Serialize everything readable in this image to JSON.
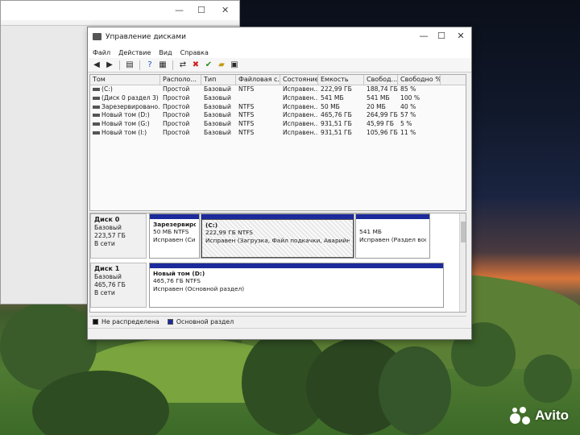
{
  "window": {
    "title": "Управление дисками",
    "controls": {
      "minimize": "—",
      "maximize": "☐",
      "close": "✕"
    }
  },
  "menu": [
    "Файл",
    "Действие",
    "Вид",
    "Справка"
  ],
  "toolbar_icons": [
    "back-arrow-icon",
    "forward-arrow-icon",
    "list-view-icon",
    "help-icon",
    "properties-icon",
    "connect-icon",
    "delete-icon",
    "check-icon",
    "folder-icon",
    "settings-icon"
  ],
  "volumes": {
    "columns": [
      "Том",
      "Располо...",
      "Тип",
      "Файловая с...",
      "Состояние",
      "Емкость",
      "Свобод...",
      "Свободно %"
    ],
    "rows": [
      [
        "(C:)",
        "Простой",
        "Базовый",
        "NTFS",
        "Исправен...",
        "222,99 ГБ",
        "188,74 ГБ",
        "85 %"
      ],
      [
        "(Диск 0 раздел 3)",
        "Простой",
        "Базовый",
        "",
        "Исправен...",
        "541 МБ",
        "541 МБ",
        "100 %"
      ],
      [
        "Зарезервировано...",
        "Простой",
        "Базовый",
        "NTFS",
        "Исправен...",
        "50 МБ",
        "20 МБ",
        "40 %"
      ],
      [
        "Новый том (D:)",
        "Простой",
        "Базовый",
        "NTFS",
        "Исправен...",
        "465,76 ГБ",
        "264,99 ГБ",
        "57 %"
      ],
      [
        "Новый том (G:)",
        "Простой",
        "Базовый",
        "NTFS",
        "Исправен...",
        "931,51 ГБ",
        "45,99 ГБ",
        "5 %"
      ],
      [
        "Новый том (I:)",
        "Простой",
        "Базовый",
        "NTFS",
        "Исправен...",
        "931,51 ГБ",
        "105,96 ГБ",
        "11 %"
      ]
    ]
  },
  "disks": [
    {
      "name": "Диск 0",
      "type": "Базовый",
      "size": "223,57 ГБ",
      "status": "В сети",
      "partitions": [
        {
          "name": "Зарезервиров",
          "size": "50 МБ NTFS",
          "status": "Исправен (Сис"
        },
        {
          "name": "(C:)",
          "size": "222,99 ГБ NTFS",
          "status": "Исправен (Загрузка, Файл подкачки, Аварийный дам"
        },
        {
          "name": "",
          "size": "541 МБ",
          "status": "Исправен (Раздел восста"
        }
      ]
    },
    {
      "name": "Диск 1",
      "type": "Базовый",
      "size": "465,76 ГБ",
      "status": "В сети",
      "partitions": [
        {
          "name": "Новый том  (D:)",
          "size": "465,76 ГБ NTFS",
          "status": "Исправен (Основной раздел)"
        }
      ]
    }
  ],
  "legend": [
    {
      "label": "Не распределена",
      "color": "#111111"
    },
    {
      "label": "Основной раздел",
      "color": "#1c2a9c"
    }
  ],
  "watermark": {
    "text": "Avito"
  }
}
